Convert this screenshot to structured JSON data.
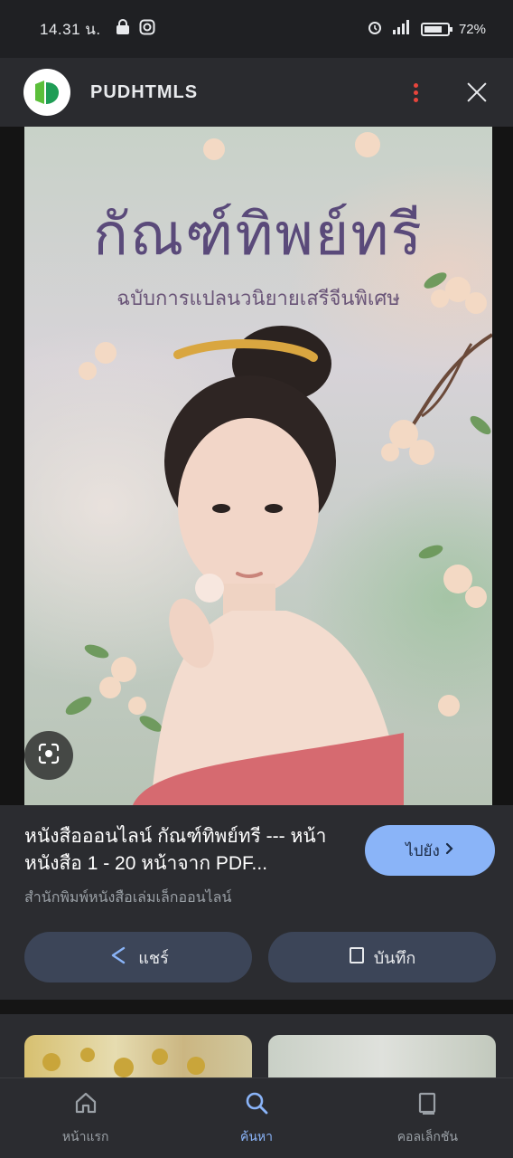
{
  "status_bar": {
    "time": "14.31 น.",
    "battery": "72%"
  },
  "header": {
    "app_title": "PUDHTMLS",
    "logo_icon": "app-logo",
    "accent_color": "#8ab4f8"
  },
  "image": {
    "cover_title": "กัณฑ์ทิพย์ทรี",
    "cover_subtitle": "ฉบับการแปลนวนิยายเสรีจีนพิเศษ"
  },
  "result": {
    "title": "หนังสือออนไลน์ กัณฑ์ทิพย์ทรี --- หน้าหนังสือ 1 - 20 หน้าจาก PDF...",
    "source": "สำนักพิมพ์หนังสือเล่มเล็กออนไลน์",
    "visit_label": "ไปยัง",
    "share_label": "แชร์",
    "save_label": "บันทึก"
  },
  "bottom_nav": {
    "items": [
      {
        "label": "หน้าแรก",
        "icon": "home-icon"
      },
      {
        "label": "ค้นหา",
        "icon": "search-icon"
      },
      {
        "label": "คอลเล็กชัน",
        "icon": "collections-icon"
      }
    ],
    "active_index": 1
  }
}
